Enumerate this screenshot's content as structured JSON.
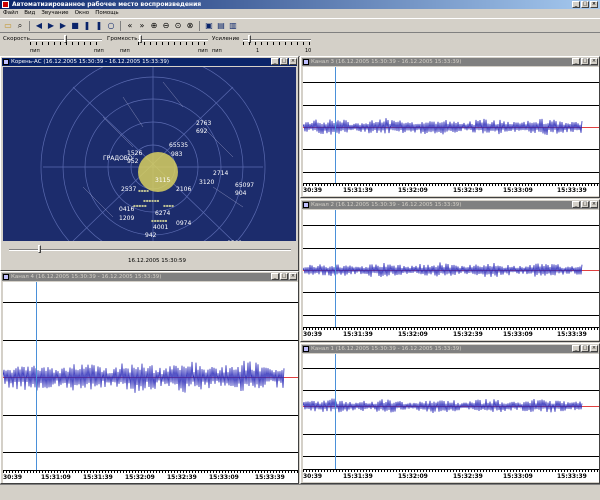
{
  "window": {
    "title": "Автоматизированное рабочее место воспроизведения"
  },
  "menu": [
    "Файл",
    "Вид",
    "Звучание",
    "Окно",
    "Помощь"
  ],
  "toolbar": {
    "icons": [
      "open-icon",
      "search-icon",
      "rewind-icon",
      "play-icon",
      "play-icon",
      "stop-icon",
      "pause-icon",
      "pause-icon",
      "loop-icon",
      "skip-back-icon",
      "skip-forward-icon",
      "zoom-in-icon",
      "zoom-out-icon",
      "zoom-fit-icon",
      "zoom-region-icon",
      "window-icon",
      "tile-icon",
      "cascade-icon"
    ]
  },
  "sliders": {
    "speed_label": "Скорость",
    "volume_label": "Громкость",
    "gain_label": "Усиление",
    "speed_ticks": [
      "пип",
      "пип"
    ],
    "volume_ticks": [
      "пип",
      "пип"
    ],
    "gain_ticks": [
      "пип",
      "1",
      "10"
    ]
  },
  "radar_panel": {
    "title": "Корень-АС (16.12.2005 15:30:39 - 16.12.2005 15:33:39)",
    "timestamp": "16.12.2005 15:30:59",
    "place_label": "ГРАДОВО",
    "labels": [
      "2763",
      "692",
      "65535",
      "983",
      "2714",
      "65097",
      "904",
      "1526",
      "952",
      "3115",
      "2106",
      "2537",
      "0416",
      "1209",
      "6274",
      "942",
      "0501",
      "0974",
      "3120",
      "4001"
    ]
  },
  "channels": [
    {
      "title": "Канал 3 (16.12.2005 15:30:39 - 16.12.2005 15:33:39)",
      "ticks": [
        "30:39",
        "15:31:39",
        "15:32:09",
        "15:32:39",
        "15:33:09",
        "15:33:39"
      ]
    },
    {
      "title": "Канал 2 (16.12.2005 15:30:39 - 16.12.2005 15:33:39)",
      "ticks": [
        "30:39",
        "15:31:39",
        "15:32:09",
        "15:32:39",
        "15:33:09",
        "15:33:39"
      ]
    },
    {
      "title": "Канал 1 (16.12.2005 15:30:39 - 16.12.2005 15:33:39)",
      "ticks": [
        "30:39",
        "15:31:39",
        "15:32:09",
        "15:32:39",
        "15:33:09",
        "15:33:39"
      ]
    },
    {
      "title": "Канал 4 (16.12.2005 15:30:39 - 16.12.2005 15:33:39)",
      "ticks": [
        "30:39",
        "15:31:09",
        "15:31:39",
        "15:32:09",
        "15:32:39",
        "15:33:09",
        "15:33:39"
      ]
    }
  ],
  "colors": {
    "wave": "#2a2ab8",
    "cursor": "#4a90d9",
    "baseline": "#e04040",
    "titlebar": "#0a246a"
  }
}
